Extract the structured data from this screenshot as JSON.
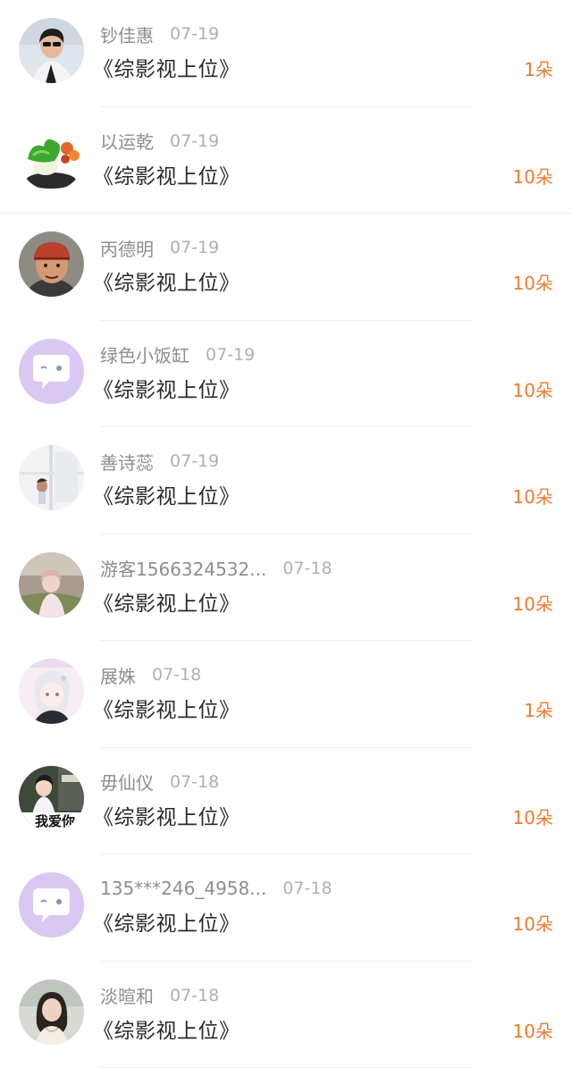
{
  "gifts": [
    {
      "name": "钞佳惠",
      "date": "07-19",
      "title": "《综影视上位》",
      "amount": "1朵",
      "avatar": "man-sunglasses-avatar"
    },
    {
      "name": "以运乾",
      "date": "07-19",
      "title": "《综影视上位》",
      "amount": "10朵",
      "avatar": "cabbage-avatar"
    },
    {
      "name": "丙德明",
      "date": "07-19",
      "title": "《综影视上位》",
      "amount": "10朵",
      "avatar": "man-bandana-avatar"
    },
    {
      "name": "绿色小饭缸",
      "date": "07-19",
      "title": "《综影视上位》",
      "amount": "10朵",
      "avatar": "default-chat-avatar"
    },
    {
      "name": "善诗蕊",
      "date": "07-19",
      "title": "《综影视上位》",
      "amount": "10朵",
      "avatar": "window-photo-avatar"
    },
    {
      "name": "游客1566324532...",
      "date": "07-18",
      "title": "《综影视上位》",
      "amount": "10朵",
      "avatar": "girl-field-avatar"
    },
    {
      "name": "展姝",
      "date": "07-18",
      "title": "《综影视上位》",
      "amount": "1朵",
      "avatar": "anime-girl-avatar"
    },
    {
      "name": "毋仙仪",
      "date": "07-18",
      "title": "《综影视上位》",
      "amount": "10朵",
      "avatar": "girl-text-avatar",
      "avatar_text": "我爱你"
    },
    {
      "name": "135***246_4958...",
      "date": "07-18",
      "title": "《综影视上位》",
      "amount": "10朵",
      "avatar": "default-chat-avatar"
    },
    {
      "name": "淡暄和",
      "date": "07-18",
      "title": "《综影视上位》",
      "amount": "10朵",
      "avatar": "woman-portrait-avatar"
    }
  ],
  "colors": {
    "amount": "#ef7b2e",
    "name": "#8e8e8e",
    "date": "#b0b0b0",
    "title": "#2a2a2a",
    "default_avatar_bg": "#d9c8f2"
  }
}
